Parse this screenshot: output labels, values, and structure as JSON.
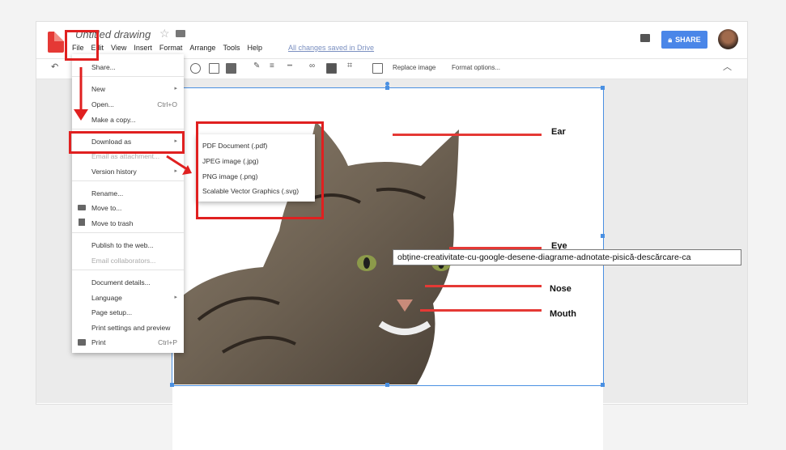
{
  "app": {
    "doc_title": "Untitled drawing",
    "saved_status": "All changes saved in Drive",
    "share_label": "SHARE"
  },
  "menubar": [
    "File",
    "Edit",
    "View",
    "Insert",
    "Format",
    "Arrange",
    "Tools",
    "Help"
  ],
  "toolbar": {
    "replace_image": "Replace image",
    "format_options": "Format options..."
  },
  "file_menu": {
    "share": "Share...",
    "new": "New",
    "open": "Open...",
    "open_shortcut": "Ctrl+O",
    "make_copy": "Make a copy...",
    "download_as": "Download as",
    "email_attachment": "Email as attachment...",
    "version_history": "Version history",
    "rename": "Rename...",
    "move_to": "Move to...",
    "move_to_trash": "Move to trash",
    "publish": "Publish to the web...",
    "email_collaborators": "Email collaborators...",
    "document_details": "Document details...",
    "language": "Language",
    "page_setup": "Page setup...",
    "print_settings": "Print settings and preview",
    "print": "Print",
    "print_shortcut": "Ctrl+P"
  },
  "download_submenu": [
    "PDF Document (.pdf)",
    "JPEG image (.jpg)",
    "PNG image (.png)",
    "Scalable Vector Graphics (.svg)"
  ],
  "callouts": {
    "ear": "Ear",
    "eye": "Eye",
    "nose": "Nose",
    "mouth": "Mouth"
  },
  "tooltip": "obține-creativitate-cu-google-desene-diagrame-adnotate-pisică-descărcare-ca",
  "colors": {
    "accent": "#4a86e8",
    "highlight": "#e02020",
    "logo": "#e53935"
  }
}
